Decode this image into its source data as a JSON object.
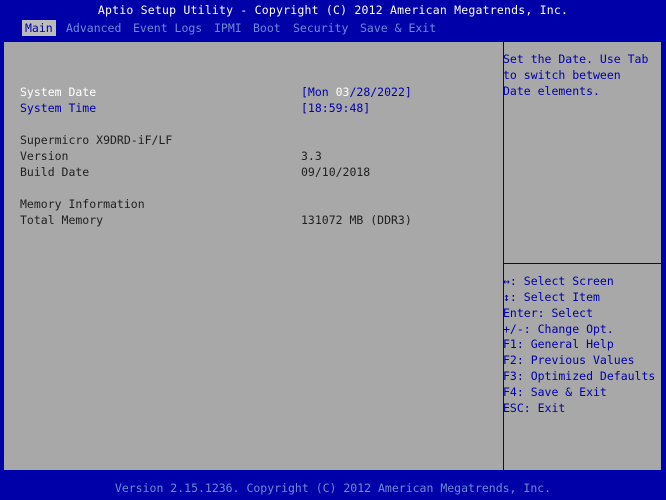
{
  "title": "Aptio Setup Utility - Copyright (C) 2012 American Megatrends, Inc.",
  "menu": [
    {
      "label": "Main",
      "active": true
    },
    {
      "label": "Advanced"
    },
    {
      "label": "Event Logs"
    },
    {
      "label": "IPMI"
    },
    {
      "label": "Boot"
    },
    {
      "label": "Security"
    },
    {
      "label": "Save & Exit"
    }
  ],
  "main": {
    "system_date": {
      "label": "System Date",
      "value_open": "[Mon ",
      "value_hl": "03",
      "value_rest": "/28/2022]"
    },
    "system_time": {
      "label": "System Time",
      "value": "[18:59:48]"
    },
    "board": {
      "label": "Supermicro X9DRD-iF/LF"
    },
    "version": {
      "label": "Version",
      "value": "3.3"
    },
    "build_date": {
      "label": "Build Date",
      "value": "09/10/2018"
    },
    "memory": {
      "label": "Memory Information"
    },
    "total_memory": {
      "label": "Total Memory",
      "value": "131072 MB (DDR3)"
    }
  },
  "help": {
    "text": "Set the Date. Use Tab\nto switch between\nDate elements."
  },
  "keys": [
    "↔: Select Screen",
    "↕: Select Item",
    "Enter: Select",
    "+/-: Change Opt.",
    "F1: General Help",
    "F2: Previous Values",
    "F3: Optimized Defaults",
    "F4: Save & Exit",
    "ESC: Exit"
  ],
  "footer": "Version 2.15.1236. Copyright (C) 2012 American Megatrends, Inc."
}
